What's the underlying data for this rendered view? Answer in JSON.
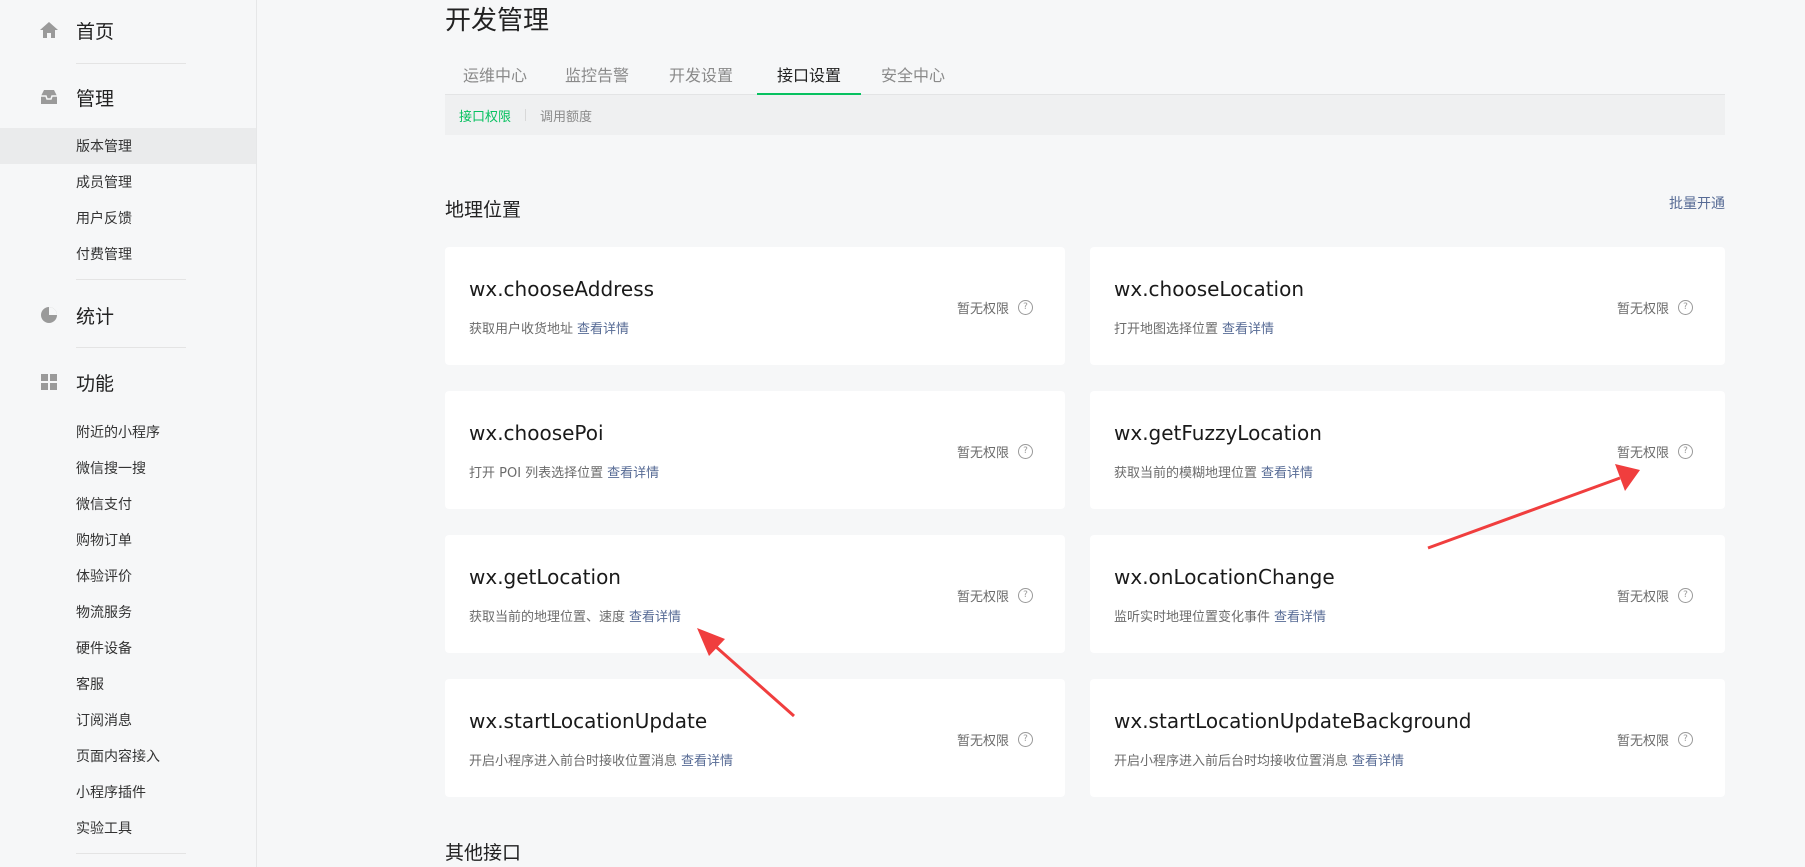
{
  "sidebar": {
    "home": {
      "label": "首页",
      "icon": "home-icon"
    },
    "manage": {
      "label": "管理",
      "icon": "inbox-icon"
    },
    "manage_items": [
      {
        "label": "版本管理",
        "active": true
      },
      {
        "label": "成员管理"
      },
      {
        "label": "用户反馈"
      },
      {
        "label": "付费管理"
      }
    ],
    "stats": {
      "label": "统计",
      "icon": "pie-chart-icon"
    },
    "features": {
      "label": "功能",
      "icon": "grid-icon"
    },
    "feature_items": [
      {
        "label": "附近的小程序"
      },
      {
        "label": "微信搜一搜"
      },
      {
        "label": "微信支付"
      },
      {
        "label": "购物订单"
      },
      {
        "label": "体验评价"
      },
      {
        "label": "物流服务"
      },
      {
        "label": "硬件设备"
      },
      {
        "label": "客服"
      },
      {
        "label": "订阅消息"
      },
      {
        "label": "页面内容接入"
      },
      {
        "label": "小程序插件"
      },
      {
        "label": "实验工具"
      }
    ]
  },
  "main": {
    "title": "开发管理",
    "tabs": [
      {
        "label": "运维中心"
      },
      {
        "label": "监控告警"
      },
      {
        "label": "开发设置"
      },
      {
        "label": "接口设置",
        "active": true
      },
      {
        "label": "安全中心"
      }
    ],
    "subtabs": [
      {
        "label": "接口权限",
        "active": true
      },
      {
        "label": "调用额度"
      }
    ],
    "section": {
      "title": "地理位置",
      "batch_label": "批量开通",
      "no_permission": "暂无权限",
      "detail_label": "查看详情",
      "apis": [
        {
          "name": "wx.chooseAddress",
          "desc": "获取用户收货地址"
        },
        {
          "name": "wx.chooseLocation",
          "desc": "打开地图选择位置"
        },
        {
          "name": "wx.choosePoi",
          "desc": "打开 POI 列表选择位置"
        },
        {
          "name": "wx.getFuzzyLocation",
          "desc": "获取当前的模糊地理位置"
        },
        {
          "name": "wx.getLocation",
          "desc": "获取当前的地理位置、速度"
        },
        {
          "name": "wx.onLocationChange",
          "desc": "监听实时地理位置变化事件"
        },
        {
          "name": "wx.startLocationUpdate",
          "desc": "开启小程序进入前台时接收位置消息"
        },
        {
          "name": "wx.startLocationUpdateBackground",
          "desc": "开启小程序进入前后台时均接收位置消息"
        }
      ]
    },
    "other_section_title": "其他接口"
  },
  "colors": {
    "accent": "#07c160",
    "link": "#576b95",
    "arrow": "#f03e3e"
  }
}
